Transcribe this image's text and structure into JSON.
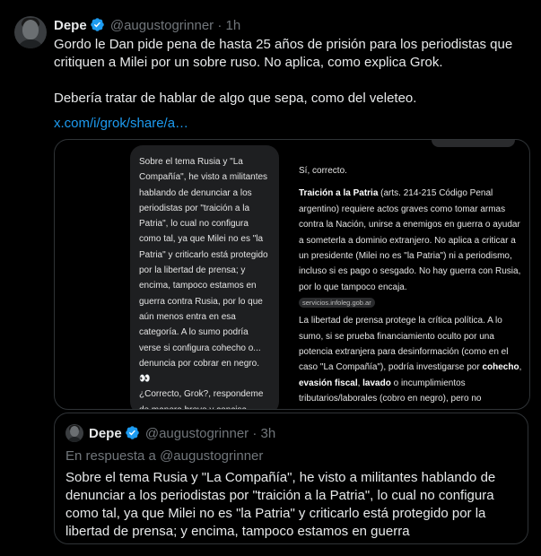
{
  "tweet": {
    "name": "Depe",
    "handle": "@augustogrinner",
    "separator": "·",
    "time": "1h",
    "paragraph1": "Gordo le Dan pide pena de hasta 25 años de prisión para los periodistas que critiquen a Milei por un sobre ruso. No aplica, como explica Grok.",
    "paragraph2": "Debería tratar de hablar de algo que sepa, como del veleteo.",
    "link": "x.com/i/grok/share/a…"
  },
  "media": {
    "user_message": "Sobre el tema Rusia y \"La Compañía\", he visto a militantes hablando de denunciar a los periodistas por \"traición a la Patria\", lo cual no configura como tal, ya que Milei no es \"la Patria\" y criticarlo está protegido por la libertad de prensa; y encima, tampoco estamos en guerra contra Rusia, por lo que aún menos entra en esa categoría. A lo sumo podría verse si configura cohecho o... denuncia por cobrar en negro.",
    "user_emoji": "👀",
    "user_tail": "¿Correcto, Grok?, respondeme de manera breve y concisa",
    "grok_intro": "Sí, correcto.",
    "grok_p1_bold": "Traición a la Patria",
    "grok_p1": " (arts. 214-215 Código Penal argentino) requiere actos graves como tomar armas contra la Nación, unirse a enemigos en guerra o ayudar a someterla a dominio extranjero. No aplica a criticar a un presidente (Milei no es \"la Patria\") ni a periodismo, incluso si es pago o sesgado. No hay guerra con Rusia, por lo que tampoco encaja.",
    "source_chip": "servicios.infoleg.gob.ar",
    "grok_p2_start": "La libertad de prensa protege la crítica política. A lo sumo, si se prueba financiamiento oculto por una potencia extranjera para desinformación (como en el caso \"La Compañía\"), podría investigarse por ",
    "grok_p2_b1": "cohecho",
    "grok_p2_sep1": ", ",
    "grok_p2_b2": "evasión fiscal",
    "grok_p2_sep2": ", ",
    "grok_p2_b3": "lavado",
    "grok_p2_end": " o incumplimientos tributarios/laborales (cobro en negro), pero no"
  },
  "quote": {
    "name": "Depe",
    "handle": "@augustogrinner",
    "separator": "·",
    "time": "3h",
    "reply_prefix": "En respuesta a ",
    "reply_handle": "@augustogrinner",
    "text": "Sobre el tema Rusia y \"La Compañía\", he visto a militantes hablando de denunciar a los periodistas por \"traición a la Patria\", lo cual no configura como tal, ya que Milei no es \"la Patria\" y criticarlo está protegido por la libertad de prensa; y encima, tampoco estamos en guerra"
  },
  "colors": {
    "background": "#000000",
    "text": "#e7e9ea",
    "muted": "#71767b",
    "link": "#1d9bf0",
    "verified": "#1d9bf0",
    "border": "#2f3336"
  },
  "icons": {
    "verified": "verified-badge-icon"
  }
}
